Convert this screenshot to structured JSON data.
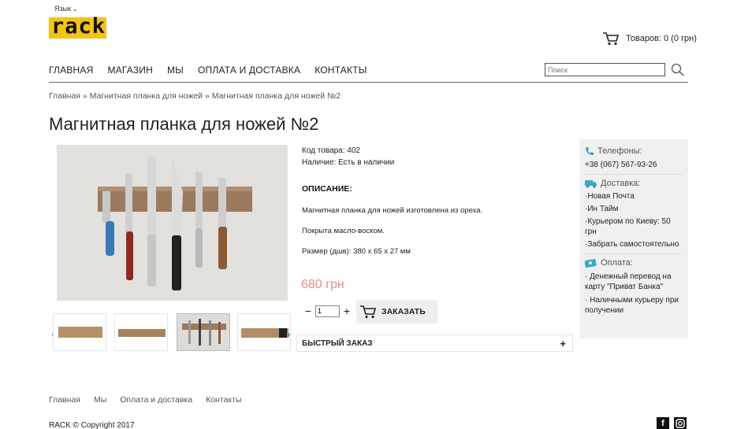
{
  "header": {
    "lang_label": "Язык",
    "logo_text": "rack",
    "cart_label": "Товаров: 0 (0 грн)"
  },
  "nav": {
    "items": [
      {
        "label": "ГЛАВНАЯ"
      },
      {
        "label": "МАГАЗИН"
      },
      {
        "label": "МЫ"
      },
      {
        "label": "ОПЛАТА И ДОСТАВКА"
      },
      {
        "label": "КОНТАКТЫ"
      }
    ],
    "search_placeholder": "Поиск"
  },
  "breadcrumbs": "Главная » Магнитная планка для ножей » Магнитная планка для ножей №2",
  "product": {
    "title": "Магнитная планка для ножей №2",
    "code": "Код товара: 402",
    "availability": "Наличие: Есть в наличии",
    "desc_heading": "ОПИСАНИЕ:",
    "desc_lines": [
      "Магнитная планка для ножей изготовлена из ореха.",
      "Покрыта масло-воском.",
      "Размер (дшв): 380 х 65 х 27 мм"
    ],
    "price": "680 грн",
    "qty": "1",
    "order_label": "ЗАКАЗАТЬ",
    "quick_order": "БЫСТРЫЙ ЗАКАЗ"
  },
  "sidebar": {
    "phones_title": "Телефоны:",
    "phone": "+38 (067) 567-93-26",
    "delivery_title": "Доставка:",
    "delivery_items": [
      "·Новая Почта",
      "·Ин Тайм",
      "·Курьером по Киеву: 50 грн",
      "·Забрать самостоятельно"
    ],
    "payment_title": "Оплата:",
    "payment_items": [
      "· Денежный перевод на карту \"Приват Банка\"",
      "· Наличными курьеру при получении"
    ]
  },
  "footer": {
    "links": [
      {
        "label": "Главная"
      },
      {
        "label": "Мы"
      },
      {
        "label": "Оплата и доставка"
      },
      {
        "label": "Контакты"
      }
    ],
    "copyright": "RACK © Copyright 2017"
  },
  "colors": {
    "logo_bg": "#f3c318",
    "price": "#e58c85",
    "accent_icon": "#3aa6c8"
  }
}
